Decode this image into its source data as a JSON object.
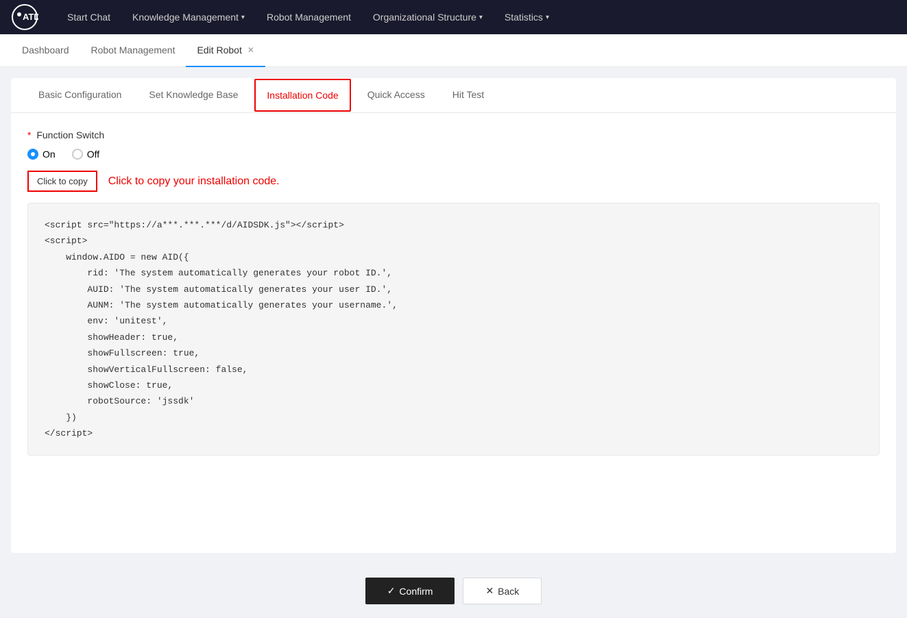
{
  "app": {
    "logo_text": "ATD"
  },
  "nav": {
    "items": [
      {
        "label": "Start Chat",
        "has_arrow": false
      },
      {
        "label": "Knowledge Management",
        "has_arrow": true
      },
      {
        "label": "Robot Management",
        "has_arrow": false
      },
      {
        "label": "Organizational Structure",
        "has_arrow": true
      },
      {
        "label": "Statistics",
        "has_arrow": true
      }
    ]
  },
  "breadcrumb": {
    "tabs": [
      {
        "label": "Dashboard",
        "active": false,
        "closable": false
      },
      {
        "label": "Robot Management",
        "active": false,
        "closable": false
      },
      {
        "label": "Edit Robot",
        "active": true,
        "closable": true
      }
    ]
  },
  "page_tabs": [
    {
      "label": "Basic Configuration",
      "active": false
    },
    {
      "label": "Set Knowledge Base",
      "active": false
    },
    {
      "label": "Installation Code",
      "active": true
    },
    {
      "label": "Quick Access",
      "active": false
    },
    {
      "label": "Hit Test",
      "active": false
    }
  ],
  "function_switch": {
    "label": "Function Switch",
    "required": true,
    "options": [
      {
        "label": "On",
        "checked": true
      },
      {
        "label": "Off",
        "checked": false
      }
    ]
  },
  "copy_button": {
    "label": "Click to copy"
  },
  "copy_hint": "Click to copy your installation code.",
  "code": "<script src=\"https://a***.***.***/d/AIDSDK.js\"></script>\n<script>\n    window.AIDO = new AID({\n        rid: 'The system automatically generates your robot ID.',\n        AUID: 'The system automatically generates your user ID.',\n        AUNM: 'The system automatically generates your username.',\n        env: 'unitest',\n        showHeader: true,\n        showFullscreen: true,\n        showVerticalFullscreen: false,\n        showClose: true,\n        robotSource: 'jssdk'\n    })\n</script>",
  "footer": {
    "confirm_label": "Confirm",
    "back_label": "Back"
  }
}
